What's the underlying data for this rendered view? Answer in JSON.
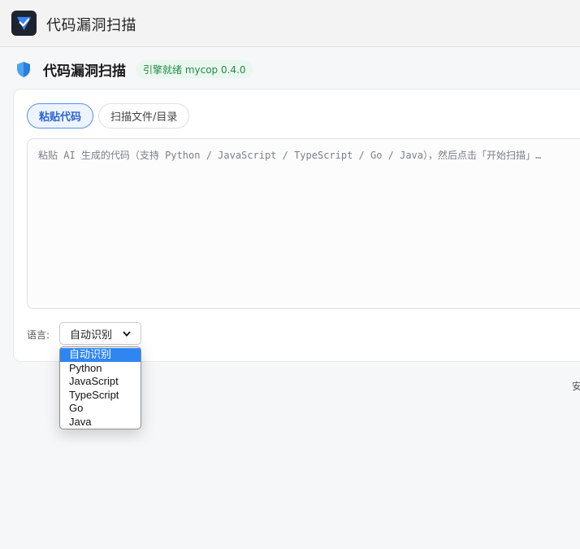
{
  "window": {
    "title": "代码漏洞扫描"
  },
  "header": {
    "title": "代码漏洞扫描",
    "status": "引擎就绪 mycop 0.4.0"
  },
  "tabs": [
    {
      "label": "粘贴代码",
      "active": true
    },
    {
      "label": "扫描文件/目录",
      "active": false
    }
  ],
  "editor": {
    "placeholder": "粘贴 AI 生成的代码（支持 Python / JavaScript / TypeScript / Go / Java），然后点击「开始扫描」…",
    "value": ""
  },
  "language": {
    "label": "语言:",
    "selected": "自动识别",
    "options": [
      "自动识别",
      "Python",
      "JavaScript",
      "TypeScript",
      "Go",
      "Java"
    ]
  },
  "right_hint": "安",
  "colors": {
    "accent": "#2c64d0",
    "status_green": "#23894a",
    "dropdown_highlight": "#2f86f0"
  }
}
